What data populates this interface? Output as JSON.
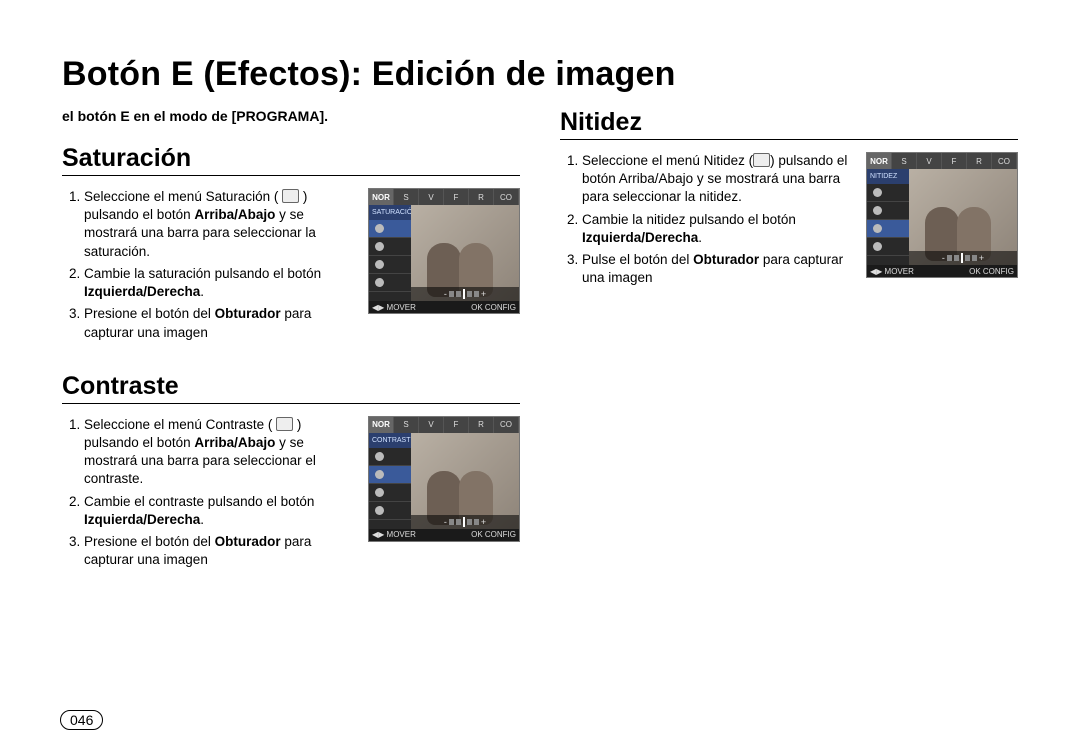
{
  "title": "Botón E (Efectos): Edición de imagen",
  "pageNumber": "046",
  "lead": "el botón E en el modo de [PROGRAMA].",
  "display": {
    "nor": "NOR",
    "tabs": [
      "S",
      "V",
      "F",
      "R",
      "CO"
    ],
    "move": "MOVER",
    "ok": "OK",
    "config": "CONFIG"
  },
  "sat": {
    "heading": "Saturación",
    "menuLabel": "SATURACIÓN",
    "s1a": "Seleccione el menú Saturación ( ",
    "s1icon": "saturation-menu-icon",
    "s1b": " ) pulsando el botón ",
    "s1c": "Arriba/Abajo",
    "s1d": " y se mostrará una barra para seleccionar la saturación.",
    "s2a": "Cambie la saturación pulsando el botón ",
    "s2b": "Izquierda/Derecha",
    "s2c": ".",
    "s3a": "Presione el botón del ",
    "s3b": "Obturador",
    "s3c": " para capturar una imagen"
  },
  "con": {
    "heading": "Contraste",
    "menuLabel": "CONTRASTE",
    "s1a": "Seleccione el menú Contraste ( ",
    "s1icon": "contrast-menu-icon",
    "s1b": " ) pulsando el botón ",
    "s1c": "Arriba/Abajo",
    "s1d": " y se mostrará una barra para seleccionar el contraste.",
    "s2a": "Cambie el contraste pulsando el botón ",
    "s2b": "Izquierda/Derecha",
    "s2c": ".",
    "s3a": "Presione el botón del ",
    "s3b": "Obturador",
    "s3c": " para capturar una imagen"
  },
  "nit": {
    "heading": "Nitidez",
    "menuLabel": "NITIDEZ",
    "s1a": "Seleccione el menú Nitidez (",
    "s1icon": "sharpness-menu-icon",
    "s1b": ") pulsando el botón Arriba/Abajo y se mostrará una barra para seleccionar la nitidez.",
    "s2a": "Cambie la nitidez pulsando el botón ",
    "s2b": "Izquierda/Derecha",
    "s2c": ".",
    "s3a": "Pulse el botón del ",
    "s3b": "Obturador",
    "s3c": " para capturar una imagen"
  }
}
